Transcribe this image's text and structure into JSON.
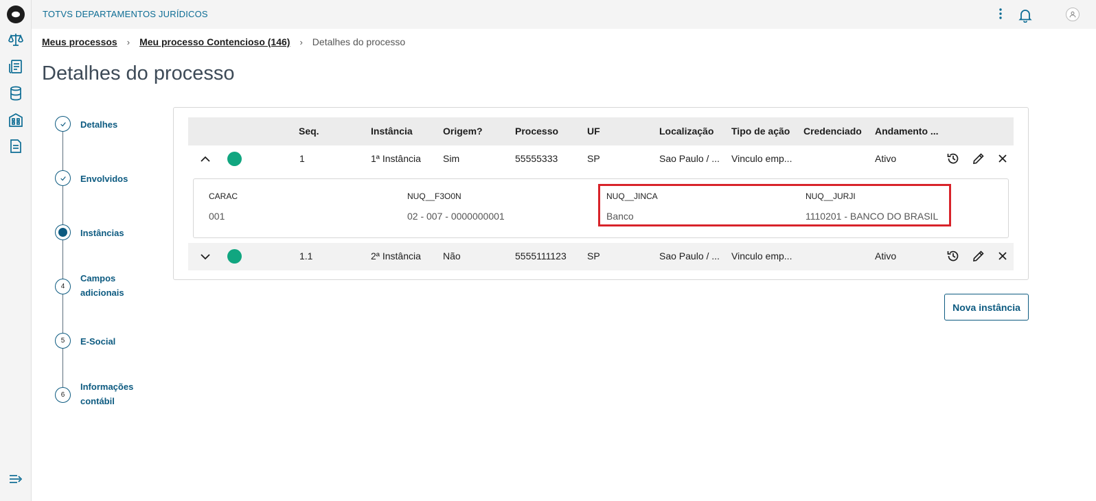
{
  "app": {
    "title": "TOTVS DEPARTAMENTOS JURÍDICOS"
  },
  "rail": {
    "icons": [
      "app-logo-icon",
      "scale-icon",
      "report-icon",
      "database-icon",
      "building-icon",
      "document-icon",
      "expand-menu-icon"
    ]
  },
  "topbar_icons": [
    "more-vertical-icon",
    "bell-icon",
    "user-icon"
  ],
  "breadcrumb": {
    "items": [
      "Meus processos",
      "Meu processo Contencioso (146)"
    ],
    "current": "Detalhes do processo"
  },
  "page": {
    "title": "Detalhes do processo"
  },
  "stepper": {
    "steps": [
      {
        "label": "Detalhes",
        "marker": "",
        "state": "done"
      },
      {
        "label": "Envolvidos",
        "marker": "",
        "state": "done"
      },
      {
        "label": "Instâncias",
        "marker": "",
        "state": "active"
      },
      {
        "label": "Campos adicionais",
        "marker": "4",
        "state": "pending"
      },
      {
        "label": "E-Social",
        "marker": "5",
        "state": "pending"
      },
      {
        "label": "Informações contábil",
        "marker": "6",
        "state": "pending"
      }
    ]
  },
  "table": {
    "columns": [
      "Seq.",
      "Instância",
      "Origem?",
      "Processo",
      "UF",
      "Localização",
      "Tipo de ação",
      "Credenciado",
      "Andamento ..."
    ],
    "rows": [
      {
        "seq": "1",
        "instancia": "1ª Instância",
        "origem": "Sim",
        "processo": "55555333",
        "uf": "SP",
        "localizacao": "Sao Paulo / ...",
        "tipo": "Vinculo emp...",
        "credenciado": "",
        "andamento": "Ativo",
        "expanded": true,
        "status_color": "#11a680"
      },
      {
        "seq": "1.1",
        "instancia": "2ª Instância",
        "origem": "Não",
        "processo": "5555111123",
        "uf": "SP",
        "localizacao": "Sao Paulo / ...",
        "tipo": "Vinculo emp...",
        "credenciado": "",
        "andamento": "Ativo",
        "expanded": false,
        "status_color": "#11a680"
      }
    ],
    "detail": {
      "fields": [
        {
          "label": "CARAC",
          "value": "001"
        },
        {
          "label": "NUQ__F3O0N",
          "value": "02 - 007 - 0000000001"
        },
        {
          "label": "NUQ__JINCA",
          "value": "Banco"
        },
        {
          "label": "NUQ__JURJI",
          "value": "1110201 - BANCO DO BRASIL"
        }
      ]
    },
    "row_actions": [
      "history-icon",
      "edit-icon",
      "close-icon"
    ]
  },
  "actions": {
    "new_instance": "Nova instância"
  },
  "colors": {
    "primary": "#0c5a80",
    "status_green": "#11a680",
    "highlight_red": "#d8232a"
  }
}
